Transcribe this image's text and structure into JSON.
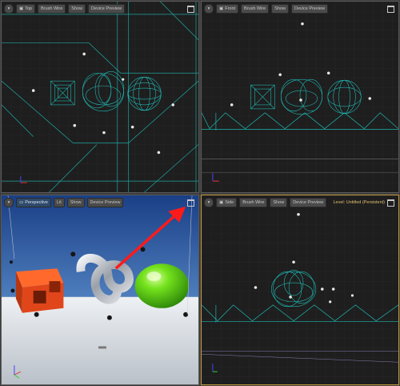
{
  "viewports": {
    "top": {
      "view": "Top",
      "mode": "Brush Wire",
      "show": "Show",
      "preview": "Device Preview"
    },
    "front": {
      "view": "Front",
      "mode": "Brush Wire",
      "show": "Show",
      "preview": "Device Preview"
    },
    "persp": {
      "view": "Perspective",
      "mode": "Lit",
      "show": "Show",
      "preview": "Device Preview"
    },
    "side": {
      "view": "Side",
      "mode": "Brush Wire",
      "show": "Show",
      "preview": "Device Preview",
      "level": "Level:  Untitled (Persistent)"
    }
  },
  "colors": {
    "wire": "#1fb5b0",
    "grid": "#2e2e2e",
    "grid_major": "#3a3a3a",
    "active_border": "#c79a3d",
    "cube": "#d84a1c",
    "sphere": "#6edc1e",
    "knot": "#c8ccd4",
    "arrow": "#ff1a1a",
    "sky_top": "#1e4d9c",
    "floor": "#d8d8d8"
  },
  "icons": [
    "menu-icon",
    "maximize-icon",
    "arrow-annotation",
    "axis-gizmo-icon"
  ]
}
